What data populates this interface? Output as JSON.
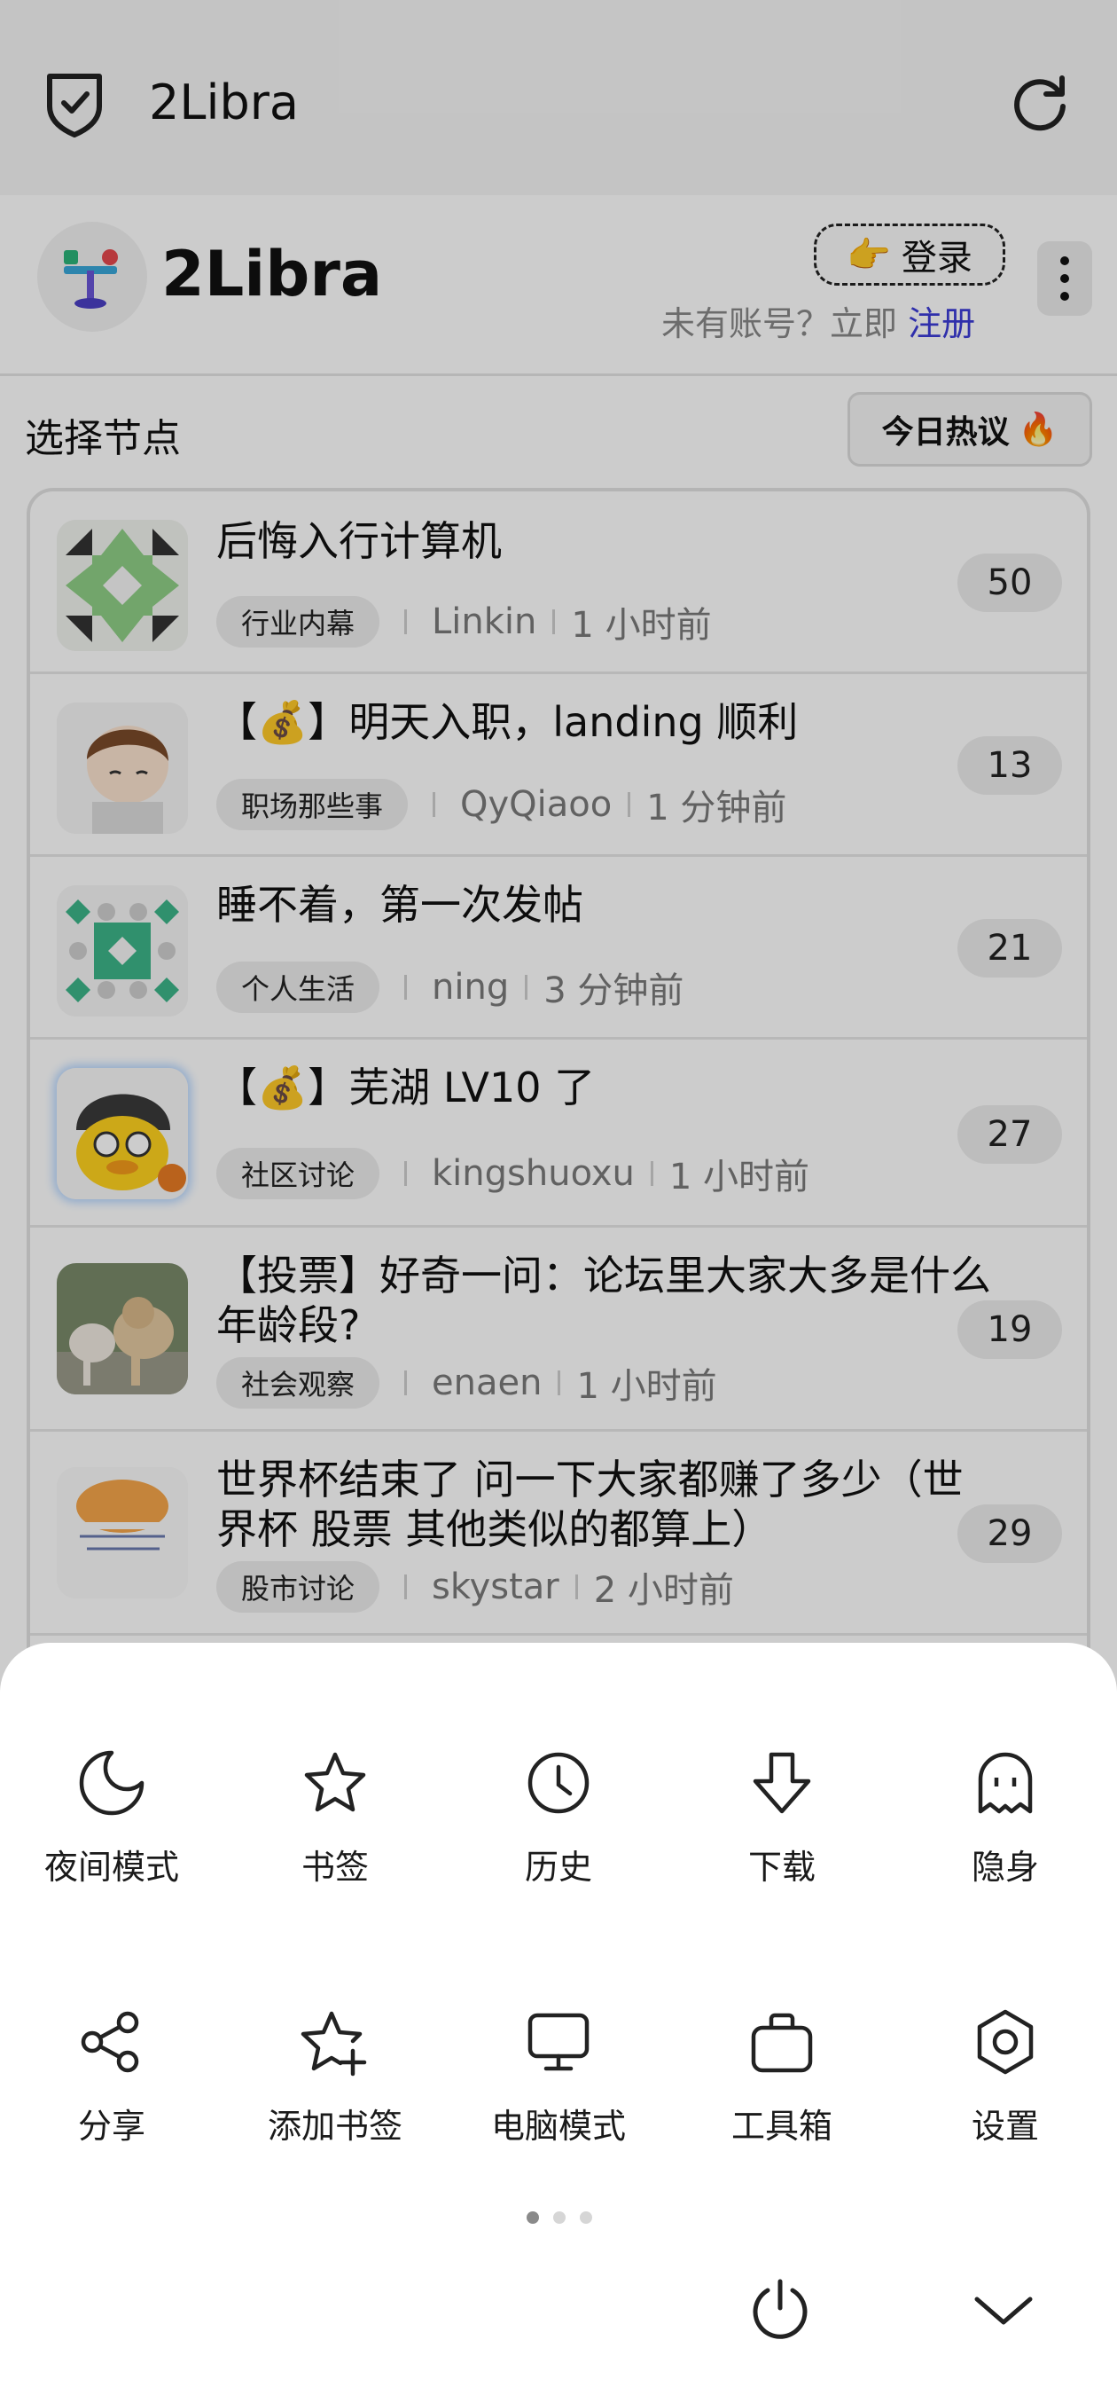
{
  "browser": {
    "title": "2Libra"
  },
  "site": {
    "name": "2Libra",
    "login_label": "登录",
    "login_emoji": "👉",
    "no_account_text": "未有账号？立即",
    "register_label": "注册"
  },
  "toolbar": {
    "node_select": "选择节点",
    "hot_label": "今日热议",
    "hot_emoji": "🔥"
  },
  "topics": [
    {
      "title": "后悔入行计算机",
      "node": "行业内幕",
      "author": "Linkin",
      "time": "1 小时前",
      "replies": "50"
    },
    {
      "title": "【💰】明天入职，landing 顺利",
      "node": "职场那些事",
      "author": "QyQiaoo",
      "time": "1 分钟前",
      "replies": "13"
    },
    {
      "title": "睡不着，第一次发帖",
      "node": "个人生活",
      "author": "ning",
      "time": "3 分钟前",
      "replies": "21"
    },
    {
      "title": "【💰】芜湖 LV10 了",
      "node": "社区讨论",
      "author": "kingshuoxu",
      "time": "1 小时前",
      "replies": "27"
    },
    {
      "title": "【投票】好奇一问：论坛里大家大多是什么年龄段?",
      "node": "社会观察",
      "author": "enaen",
      "time": "1 小时前",
      "replies": "19"
    },
    {
      "title": "世界杯结束了 问一下大家都赚了多少（世界杯 股票 其他类似的都算上）",
      "node": "股市讨论",
      "author": "skystar",
      "time": "2 小时前",
      "replies": "29"
    }
  ],
  "menu": {
    "items": [
      {
        "label": "夜间模式",
        "icon": "moon-icon"
      },
      {
        "label": "书签",
        "icon": "star-icon"
      },
      {
        "label": "历史",
        "icon": "clock-icon"
      },
      {
        "label": "下载",
        "icon": "download-icon"
      },
      {
        "label": "隐身",
        "icon": "ghost-icon"
      },
      {
        "label": "分享",
        "icon": "share-icon"
      },
      {
        "label": "添加书签",
        "icon": "star-plus-icon"
      },
      {
        "label": "电脑模式",
        "icon": "monitor-icon"
      },
      {
        "label": "工具箱",
        "icon": "toolbox-icon"
      },
      {
        "label": "设置",
        "icon": "settings-icon"
      }
    ],
    "page_indicator": {
      "current": 1,
      "total": 3
    }
  },
  "colors": {
    "link": "#3b3bd6",
    "overlay": "rgba(0,0,0,0.2)",
    "sheet": "#ffffff"
  }
}
